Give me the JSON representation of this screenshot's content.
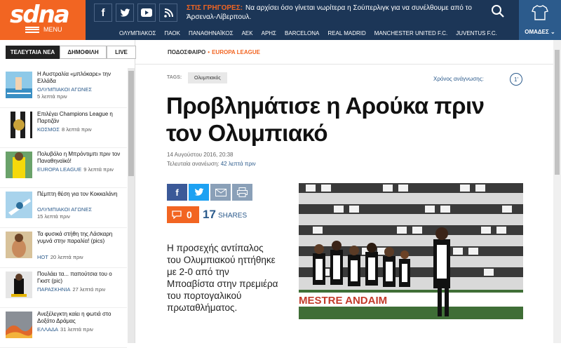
{
  "header": {
    "logo_text": "sdna",
    "menu_label": "MENU",
    "social_icons": [
      "facebook-icon",
      "twitter-icon",
      "youtube-icon",
      "rss-icon"
    ],
    "breaking_label": "ΣΤΙΣ ΓΡΗΓΟΡΕΣ:",
    "breaking_text": "Να αρχίσει όσο γίνεται νωρίτερα η Σούπερλιγκ για να συνέλθουμε από το Άρσεναλ-Λίβερπουλ.",
    "teams_label": "ΟΜΑΔΕΣ ⌄",
    "nav": [
      "ΟΛΥΜΠΙΑΚΟΣ",
      "ΠΑΟΚ",
      "ΠΑΝΑΘΗΝΑΪΚΟΣ",
      "ΑΕΚ",
      "ΑΡΗΣ",
      "BARCELONA",
      "REAL MADRID",
      "MANCHESTER UNITED F.C.",
      "JUVENTUS F.C."
    ]
  },
  "sidebar": {
    "tabs": [
      "ΤΕΛΕΥΤΑΙΑ ΝΕΑ",
      "ΔΗΜΟΦΙΛΗ",
      "LIVE"
    ],
    "items": [
      {
        "title": "Η Αυστραλία «μπλόκαρε» την Ελλάδα",
        "category": "ΟΛΥΜΠΙΑΚΟΙ ΑΓΩΝΕΣ",
        "time": "5 λεπτά πριν"
      },
      {
        "title": "Επιλέγει Champions League η Παρτιζάν",
        "category": "ΚΟΣΜΟΣ",
        "time": "8 λεπτά πριν"
      },
      {
        "title": "Πολυβόλο η Μπρόντιμπι πριν τον Παναθηναϊκό!",
        "category": "EUROPA LEAGUE",
        "time": "9 λεπτά πριν"
      },
      {
        "title": "Πέμπτη θέση για τον Κοκκαλάνη",
        "category": "ΟΛΥΜΠΙΑΚΟΙ ΑΓΩΝΕΣ",
        "time": "15 λεπτά πριν"
      },
      {
        "title": "Τα φυσικά στήθη της Λάσκαρη γυμνά στην παραλία! (pics)",
        "category": "HOT",
        "time": "20 λεπτά πριν"
      },
      {
        "title": "Πουλάει τα... παπούτσια του ο Γκιστ (pic)",
        "category": "ΠΑΡΑΣΚΗΝΙΑ",
        "time": "27 λεπτά πριν"
      },
      {
        "title": "Ανεξέλεγκτη καίει η φωτιά στο Δοξάτο Δράμας",
        "category": "ΕΛΛΑΔΑ",
        "time": "31 λεπτά πριν"
      }
    ]
  },
  "article": {
    "breadcrumb_section": "ΠΟΔΟΣΦΑΙΡΟ",
    "breadcrumb_separator": "•",
    "breadcrumb_category": "EUROPA LEAGUE",
    "tags_label": "TAGS:",
    "tag": "Ολυμπιακός",
    "read_time_label": "Χρόνος ανάγνωσης:",
    "read_time_value": "1'",
    "headline": "Προβλημάτισε η Αρούκα πριν τον Ολυμπιακό",
    "date": "14 Αυγούστου 2016, 20:38",
    "updated_label": "Τελευταία ανανέωση:",
    "updated_value": "42 λεπτά πριν",
    "comments_count": "0",
    "shares_count": "17",
    "shares_label": "SHARES",
    "lead": "Η προσεχής αντίπαλος του Ολυμπιακού ηττήθηκε με 2-0 από την Μποαβίστα στην πρεμιέρα του πορτογαλικού πρωταθλήματος.",
    "photo_banner": "MESTRE ANDAIM"
  },
  "colors": {
    "brand_orange": "#f26522",
    "header_navy": "#1c3657",
    "link_blue": "#2c5b8c",
    "facebook": "#3b5998",
    "twitter": "#1da1f2",
    "email": "#8aa0b8"
  }
}
